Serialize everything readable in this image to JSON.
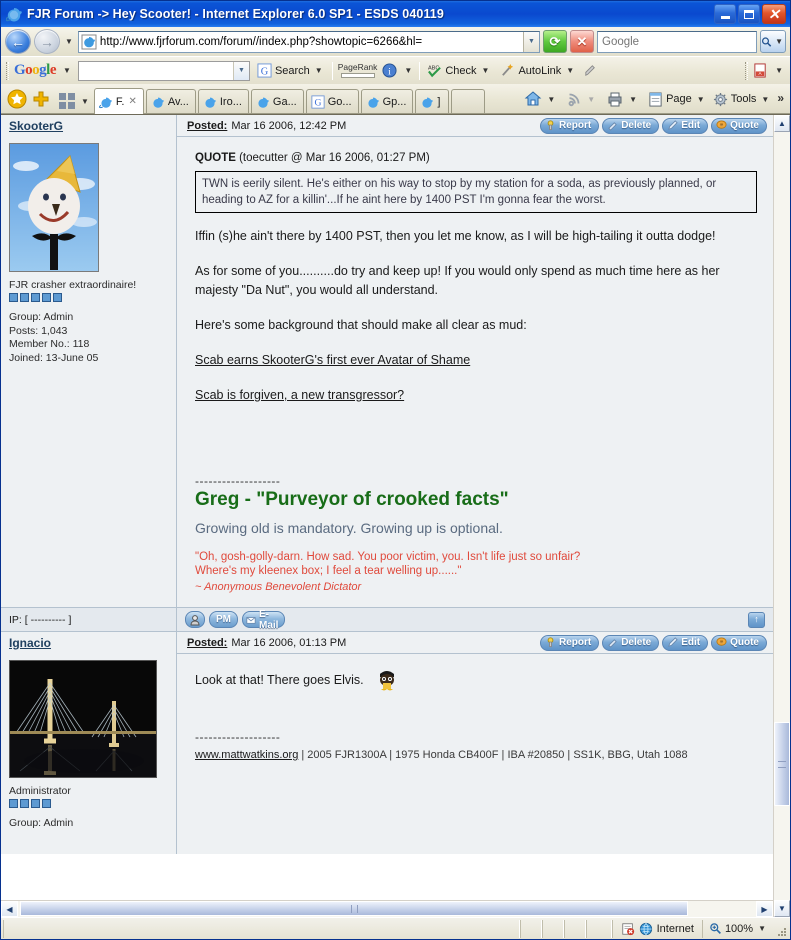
{
  "window": {
    "title": "FJR Forum -> Hey Scooter! - Internet Explorer 6.0 SP1 - ESDS 040119",
    "minimize_label": "Minimize",
    "maximize_label": "Maximize",
    "close_label": "Close"
  },
  "nav": {
    "back_label": "Back",
    "forward_label": "Forward",
    "url": "http://www.fjrforum.com/forum//index.php?showtopic=6266&hl=",
    "go_label": "Go",
    "stop_label": "Stop",
    "search_placeholder": "Google",
    "search_value": ""
  },
  "google_toolbar": {
    "logo": "Google",
    "search_value": "",
    "search_label": "Search",
    "pagerank_label": "PageRank",
    "check_label": "Check",
    "autolink_label": "AutoLink",
    "highlighter_label": "Highlight"
  },
  "tabs": [
    {
      "label": "F.",
      "active": true,
      "icon": "ie-icon"
    },
    {
      "label": "Av...",
      "active": false,
      "icon": "ie-icon"
    },
    {
      "label": "Iro...",
      "active": false,
      "icon": "ie-icon"
    },
    {
      "label": "Ga...",
      "active": false,
      "icon": "ie-icon"
    },
    {
      "label": "Go...",
      "active": false,
      "icon": "google-icon"
    },
    {
      "label": "Gp...",
      "active": false,
      "icon": "ie-icon"
    },
    {
      "label": "]",
      "active": false,
      "icon": "ie-icon"
    }
  ],
  "toolbar_right": {
    "home_label": "Home",
    "feeds_label": "Feeds",
    "print_label": "Print",
    "page_label": "Page",
    "tools_label": "Tools",
    "overflow_label": "More"
  },
  "posts": [
    {
      "author": "SkooterG",
      "posted_label": "Posted:",
      "posted_date": "Mar 16 2006, 12:42 PM",
      "user_title": "FJR crasher extraordinaire!",
      "pips": 5,
      "stats": [
        "Group: Admin",
        "Posts: 1,043",
        "Member No.: 118",
        "Joined: 13-June 05"
      ],
      "quote_header_label": "QUOTE",
      "quote_header_meta": "(toecutter @ Mar 16 2006, 01:27 PM)",
      "quote_text": "TWN is eerily silent. He's either on his way to stop by my station for a soda, as previously planned, or heading to AZ for a killin'...If he aint here by 1400 PST I'm gonna fear the worst.",
      "paragraphs": [
        "Iffin (s)he ain't there by 1400 PST, then you let me know, as I will be high-tailing it outta dodge!",
        "As for some of you..........do try and keep up! If you would only spend as much time here as her majesty \"Da Nut\", you would all understand.",
        "Here's some background that should make all clear as mud:"
      ],
      "links": [
        "Scab earns SkooterG's first ever Avatar of Shame",
        "Scab is forgiven, a new transgressor?"
      ],
      "sig_divider": "-------------------",
      "sig_title": "Greg - \"Purveyor of crooked facts\"",
      "sig_sub": "Growing old is mandatory. Growing up is optional.",
      "sig_quote_line1": "\"Oh, gosh-golly-darn. How sad. You poor victim, you. Isn't life just so unfair?",
      "sig_quote_line2": "Where's my kleenex box; I feel a tear welling up......\"",
      "sig_attribution": "~ Anonymous Benevolent Dictator",
      "ip_text": "IP: [ ---------- ]"
    },
    {
      "author": "Ignacio",
      "posted_label": "Posted:",
      "posted_date": "Mar 16 2006, 01:13 PM",
      "user_title": "Administrator",
      "pips": 4,
      "stats": [
        "Group: Admin"
      ],
      "body_text": "Look at that! There goes Elvis.",
      "sig_divider": "-------------------",
      "sig_link": "www.mattwatkins.org",
      "sig_rest": " | 2005 FJR1300A | 1975 Honda CB400F | IBA #20850 | SS1K, BBG, Utah 1088"
    }
  ],
  "post_buttons": [
    {
      "label": "Report",
      "icon": "report-icon"
    },
    {
      "label": "Delete",
      "icon": "delete-icon"
    },
    {
      "label": "Edit",
      "icon": "edit-icon"
    },
    {
      "label": "Quote",
      "icon": "quote-icon"
    }
  ],
  "ip_buttons": [
    {
      "label": "",
      "icon": "profile-icon"
    },
    {
      "label": "PM",
      "icon": "pm-icon"
    },
    {
      "label": "E-Mail",
      "icon": "email-icon"
    }
  ],
  "top_button_label": "Top",
  "statusbar": {
    "zone": "Internet",
    "zoom": "100%"
  }
}
